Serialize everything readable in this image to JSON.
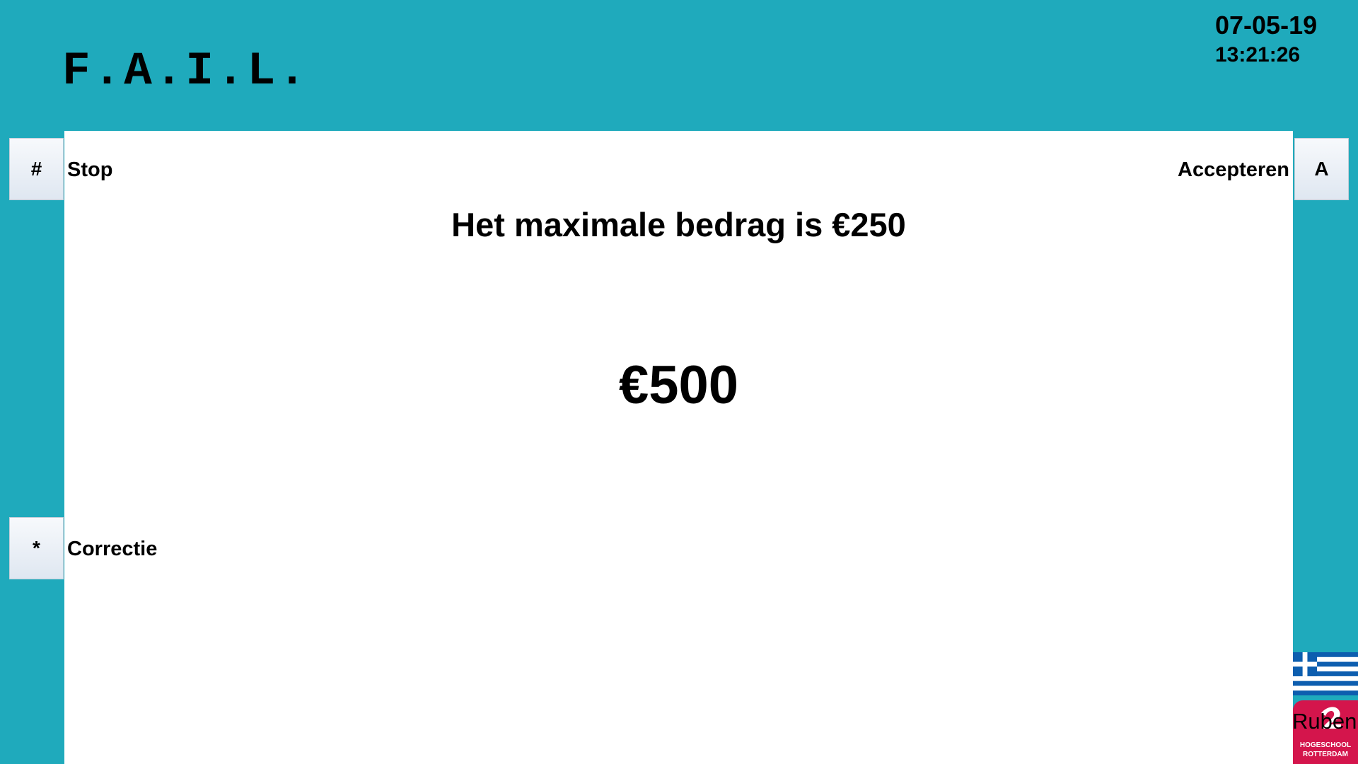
{
  "app": {
    "logo": "F.A.I.L."
  },
  "clock": {
    "date": "07-05-19",
    "time": "13:21:26"
  },
  "left_keys": [
    {
      "key": "#",
      "label": "Stop"
    },
    {
      "key": "*",
      "label": "Correctie"
    }
  ],
  "right_keys": [
    {
      "key": "A",
      "label": "Accepteren"
    }
  ],
  "main": {
    "message": "Het maximale bedrag is €250",
    "amount": "€500"
  },
  "footer": {
    "language_flag": "greece-flag-icon",
    "school_line1": "HOGESCHOOL",
    "school_line2": "ROTTERDAM",
    "user_name": "Ruben"
  },
  "colors": {
    "background": "#1faabc",
    "panel": "#ffffff",
    "school_red": "#d4154c",
    "flag_blue": "#0d5eaf"
  }
}
